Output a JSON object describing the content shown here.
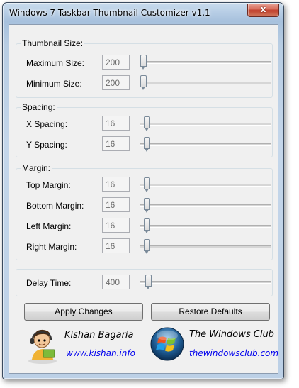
{
  "window": {
    "title": "Windows 7 Taskbar Thumbnail Customizer v1.1",
    "close_glyph": "x"
  },
  "groups": {
    "thumbnail_size": {
      "title": "Thumbnail Size:",
      "rows": [
        {
          "label": "Maximum Size:",
          "value": "200",
          "slider_fraction": 0.0
        },
        {
          "label": "Minimum Size:",
          "value": "200",
          "slider_fraction": 0.0
        }
      ]
    },
    "spacing": {
      "title": "Spacing:",
      "rows": [
        {
          "label": "X Spacing:",
          "value": "16",
          "slider_fraction": 0.03
        },
        {
          "label": "Y Spacing:",
          "value": "16",
          "slider_fraction": 0.03
        }
      ]
    },
    "margin": {
      "title": "Margin:",
      "rows": [
        {
          "label": "Top Margin:",
          "value": "16",
          "slider_fraction": 0.03
        },
        {
          "label": "Bottom Margin:",
          "value": "16",
          "slider_fraction": 0.03
        },
        {
          "label": "Left Margin:",
          "value": "16",
          "slider_fraction": 0.03
        },
        {
          "label": "Right Margin:",
          "value": "16",
          "slider_fraction": 0.03
        }
      ]
    },
    "delay": {
      "rows": [
        {
          "label": "Delay Time:",
          "value": "400",
          "slider_fraction": 0.04
        }
      ]
    }
  },
  "buttons": {
    "apply": "Apply Changes",
    "restore": "Restore Defaults"
  },
  "credits": {
    "author_name": "Kishan Bagaria",
    "author_link": "www.kishan.info",
    "club_name": "The Windows Club",
    "club_link": "thewindowsclub.com"
  },
  "colors": {
    "link": "#0000ee",
    "field_text": "#6d6d6d"
  }
}
